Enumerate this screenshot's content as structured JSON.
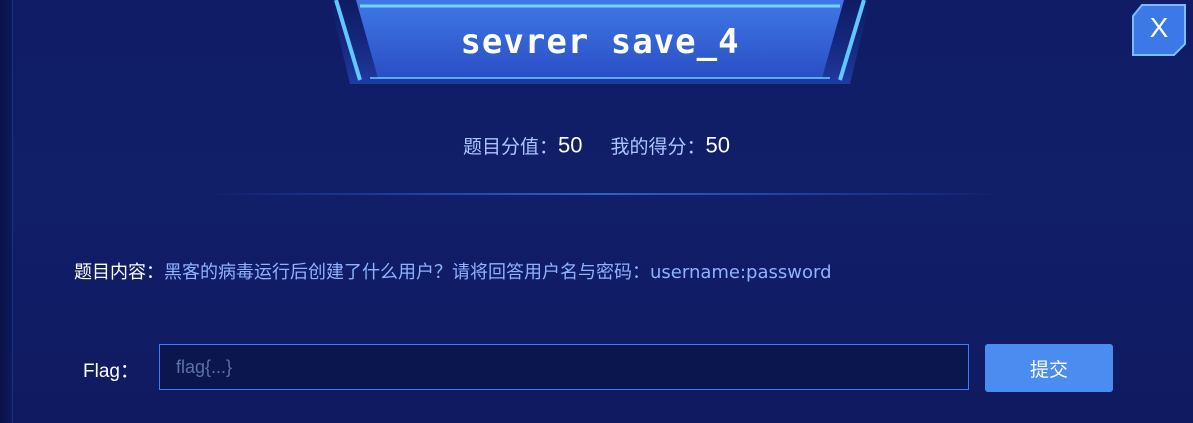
{
  "dialog": {
    "title": "sevrer save_4",
    "close_label": "X"
  },
  "score": {
    "points_label": "题目分值：",
    "points_value": "50",
    "my_score_label": "我的得分：",
    "my_score_value": "50"
  },
  "question": {
    "label": "题目内容：",
    "text": "黑客的病毒运行后创建了什么用户？请将回答用户名与密码：username:password"
  },
  "flag": {
    "label": "Flag：",
    "value": "",
    "placeholder": "flag{...}",
    "submit_label": "提交"
  },
  "colors": {
    "background": "#101c66",
    "accent": "#4a8cf0",
    "input_border": "#3d7bff",
    "question_text": "#8fb2ff"
  }
}
